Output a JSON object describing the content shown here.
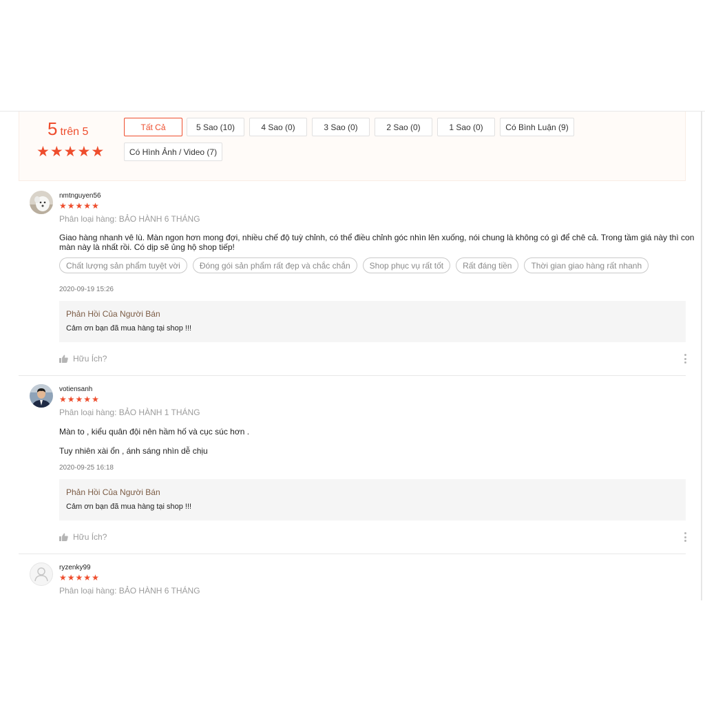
{
  "rating_summary": {
    "score": "5",
    "out_of": "trên 5",
    "star_count": 5
  },
  "filters": [
    {
      "label": "Tất Cả",
      "active": true
    },
    {
      "label": "5 Sao (10)",
      "active": false
    },
    {
      "label": "4 Sao (0)",
      "active": false
    },
    {
      "label": "3 Sao (0)",
      "active": false
    },
    {
      "label": "2 Sao (0)",
      "active": false
    },
    {
      "label": "1 Sao (0)",
      "active": false
    },
    {
      "label": "Có Bình Luận (9)",
      "active": false
    },
    {
      "label": "Có Hình Ảnh / Video (7)",
      "active": false
    }
  ],
  "reviews": [
    {
      "username": "nmtnguyen56",
      "stars": 5,
      "variant": "Phân loại hàng: BẢO HÀNH 6 THÁNG",
      "text_lines": [
        "Giao hàng nhanh vê lù. Màn ngon hơn mong đợi, nhiều chế độ tuỳ chỉnh, có thể điều chỉnh góc nhìn lên xuống, nói chung là không có gì để chê cả. Trong tầm giá này thì con",
        "màn này là nhất rồi. Có dịp sẽ ủng hộ shop tiếp!"
      ],
      "tags": [
        "Chất lượng sản phẩm tuyệt vời",
        "Đóng gói sản phẩm rất đẹp và chắc chắn",
        "Shop phục vụ rất tốt",
        "Rất đáng tiền",
        "Thời gian giao hàng rất nhanh"
      ],
      "time": "2020-09-19 15:26",
      "reply_title": "Phản Hồi Của Người Bán",
      "reply_text": "Cảm ơn bạn đã mua hàng tại shop !!!",
      "helpful": "Hữu Ích?"
    },
    {
      "username": "votiensanh",
      "stars": 5,
      "variant": "Phân loại hàng: BẢO HÀNH 1 THÁNG",
      "text_lines": [
        "Màn to , kiểu quân đội nên hầm hố và cục súc hơn .",
        "Tuy nhiên xài ổn , ánh sáng nhìn dễ chịu"
      ],
      "time": "2020-09-25 16:18",
      "reply_title": "Phản Hồi Của Người Bán",
      "reply_text": "Cảm ơn bạn đã mua hàng tại shop !!!",
      "helpful": "Hữu Ích?"
    },
    {
      "username": "ryzenky99",
      "stars": 5,
      "variant": "Phân loại hàng: BẢO HÀNH 6 THÁNG"
    }
  ],
  "colors": {
    "accent": "#ee4d2d",
    "reply_title": "#7b5b44",
    "muted": "#9b9b9b"
  }
}
